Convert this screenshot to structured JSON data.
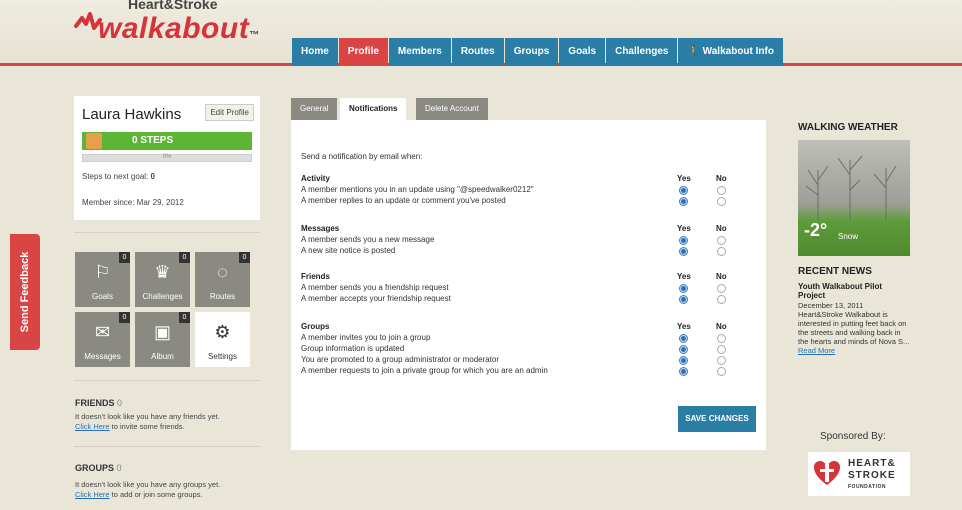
{
  "brand": {
    "top": "Heart&Stroke",
    "main": "walkabout",
    "tm": "™"
  },
  "nav": [
    {
      "label": "Home",
      "active": false
    },
    {
      "label": "Profile",
      "active": true
    },
    {
      "label": "Members",
      "active": false
    },
    {
      "label": "Routes",
      "active": false
    },
    {
      "label": "Groups",
      "active": false
    },
    {
      "label": "Goals",
      "active": false
    },
    {
      "label": "Challenges",
      "active": false
    },
    {
      "label": "🚶 Walkabout Info",
      "active": false
    }
  ],
  "feedback": {
    "label": "Send Feedback"
  },
  "profile": {
    "name": "Laura Hawkins",
    "edit_label": "Edit Profile",
    "steps": "0 STEPS",
    "progress_pct": "0%",
    "progress": 0,
    "next_goal_label": "Steps to next goal:",
    "next_goal_value": "0",
    "member_since": "Member since: Mar 29, 2012"
  },
  "tiles": [
    {
      "label": "Goals",
      "icon": "flag-icon",
      "glyph": "⚐",
      "count": "0"
    },
    {
      "label": "Challenges",
      "icon": "trophy-icon",
      "glyph": "♛",
      "count": "0"
    },
    {
      "label": "Routes",
      "icon": "route-icon",
      "glyph": "◌",
      "count": "0"
    },
    {
      "label": "Messages",
      "icon": "envelope-icon",
      "glyph": "✉",
      "count": "0"
    },
    {
      "label": "Album",
      "icon": "album-icon",
      "glyph": "▣",
      "count": "0"
    },
    {
      "label": "Settings",
      "icon": "gear-icon",
      "glyph": "⚙",
      "count": ""
    }
  ],
  "friends": {
    "title": "FRIENDS",
    "count": "0",
    "text": "It doesn't look like you have any friends yet.",
    "link": "Click Here",
    "link_suffix": " to invite some friends."
  },
  "groups": {
    "title": "GROUPS",
    "count": "0",
    "text": "It doesn't look like you have any groups yet.",
    "link": "Click Here",
    "link_suffix": " to add or join some groups."
  },
  "tabs": [
    {
      "label": "General",
      "active": false
    },
    {
      "label": "Notifications",
      "active": true
    },
    {
      "label": "Delete Account",
      "active": false
    }
  ],
  "notifications": {
    "intro": "Send a notification by email when:",
    "yes_label": "Yes",
    "no_label": "No",
    "sections": [
      {
        "title": "Activity",
        "rows": [
          {
            "text": "A member mentions you in an update using \"@speedwalker0212\"",
            "value": "yes"
          },
          {
            "text": "A member replies to an update or comment you've posted",
            "value": "yes"
          }
        ]
      },
      {
        "title": "Messages",
        "rows": [
          {
            "text": "A member sends you a new message",
            "value": "yes"
          },
          {
            "text": "A new site notice is posted",
            "value": "yes"
          }
        ]
      },
      {
        "title": "Friends",
        "rows": [
          {
            "text": "A member sends you a friendship request",
            "value": "yes"
          },
          {
            "text": "A member accepts your friendship request",
            "value": "yes"
          }
        ]
      },
      {
        "title": "Groups",
        "rows": [
          {
            "text": "A member invites you to join a group",
            "value": "yes"
          },
          {
            "text": "Group information is updated",
            "value": "yes"
          },
          {
            "text": "You are promoted to a group administrator or moderator",
            "value": "yes"
          },
          {
            "text": "A member requests to join a private group for which you are an admin",
            "value": "yes"
          }
        ]
      }
    ],
    "save_label": "SAVE CHANGES"
  },
  "weather": {
    "title": "WALKING WEATHER",
    "temp": "-2°",
    "desc": "Snow"
  },
  "news": {
    "title": "RECENT NEWS",
    "item_title": "Youth Walkabout Pilot Project",
    "date": "December 13, 2011",
    "body": "Heart&Stroke Walkabout is interested in putting feet back on the streets and walking back in the hearts and minds of Nova S...",
    "link": "Read More"
  },
  "sponsor": {
    "label": "Sponsored By:",
    "line1": "HEART&",
    "line2": "STROKE",
    "line3": "FOUNDATION"
  },
  "colors": {
    "accent_red": "#d94545",
    "nav_blue": "#2a7ea6",
    "steps_green": "#5db535",
    "background": "#e9e6d8"
  }
}
